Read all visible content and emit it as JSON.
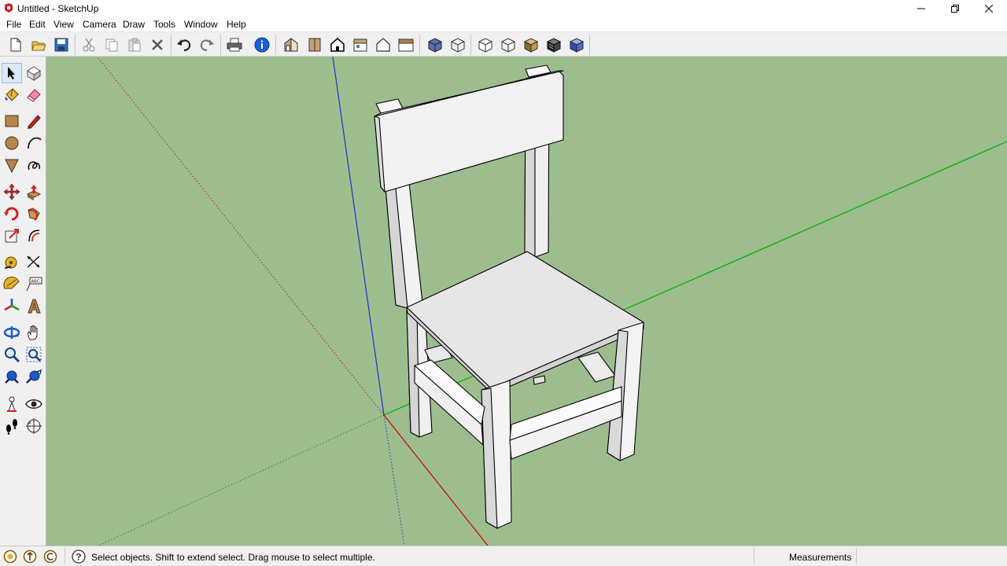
{
  "window": {
    "title": "Untitled - SketchUp",
    "controls": [
      "minimize-icon",
      "restore-icon",
      "close-icon"
    ]
  },
  "menu": [
    "File",
    "Edit",
    "View",
    "Camera",
    "Draw",
    "Tools",
    "Window",
    "Help"
  ],
  "toolbar": {
    "groups": [
      [
        "new-icon",
        "open-icon",
        "save-icon"
      ],
      [
        "cut-icon",
        "copy-icon",
        "paste-icon",
        "erase-icon",
        "undo-icon",
        "redo-icon",
        "print-icon",
        "model-info-icon"
      ],
      [
        "iso-view-icon",
        "top-view-icon",
        "front-view-icon",
        "right-view-icon",
        "back-view-icon",
        "left-view-icon"
      ],
      [
        "xray-icon",
        "wireframe-icon",
        "hidden-line-icon",
        "shaded-icon",
        "shaded-textures-icon",
        "monochrome-icon"
      ]
    ]
  },
  "left_tools": [
    [
      "select-icon",
      "make-component-icon"
    ],
    [
      "paint-bucket-icon",
      "eraser-icon"
    ],
    [
      "rectangle-icon",
      "line-icon"
    ],
    [
      "circle-icon",
      "arc-icon"
    ],
    [
      "polygon-icon",
      "freehand-icon"
    ],
    [
      "move-icon",
      "push-pull-icon"
    ],
    [
      "rotate-icon",
      "follow-me-icon"
    ],
    [
      "scale-icon",
      "offset-icon"
    ],
    [
      "tape-measure-icon",
      "dimension-icon"
    ],
    [
      "protractor-icon",
      "text-icon"
    ],
    [
      "axes-icon",
      "3d-text-icon"
    ],
    [
      "orbit-icon",
      "pan-icon"
    ],
    [
      "zoom-icon",
      "zoom-window-icon"
    ],
    [
      "zoom-extents-icon",
      "previous-view-icon"
    ],
    [
      "position-camera-icon",
      "look-around-icon"
    ],
    [
      "walk-icon",
      "section-plane-icon"
    ]
  ],
  "colors": {
    "viewport_bg": "#9dbd8f",
    "red_axis": "#c00000",
    "green_axis": "#00b000",
    "blue_axis": "#0000c8",
    "model_face": "#ececec"
  },
  "status": {
    "icons": [
      "geo-location-icon",
      "credits-icon",
      "user-icon"
    ],
    "help_icon": "help-icon",
    "hint": "Select objects. Shift to extend select. Drag mouse to select multiple.",
    "measurements_label": "Measurements",
    "measurements_value": ""
  }
}
